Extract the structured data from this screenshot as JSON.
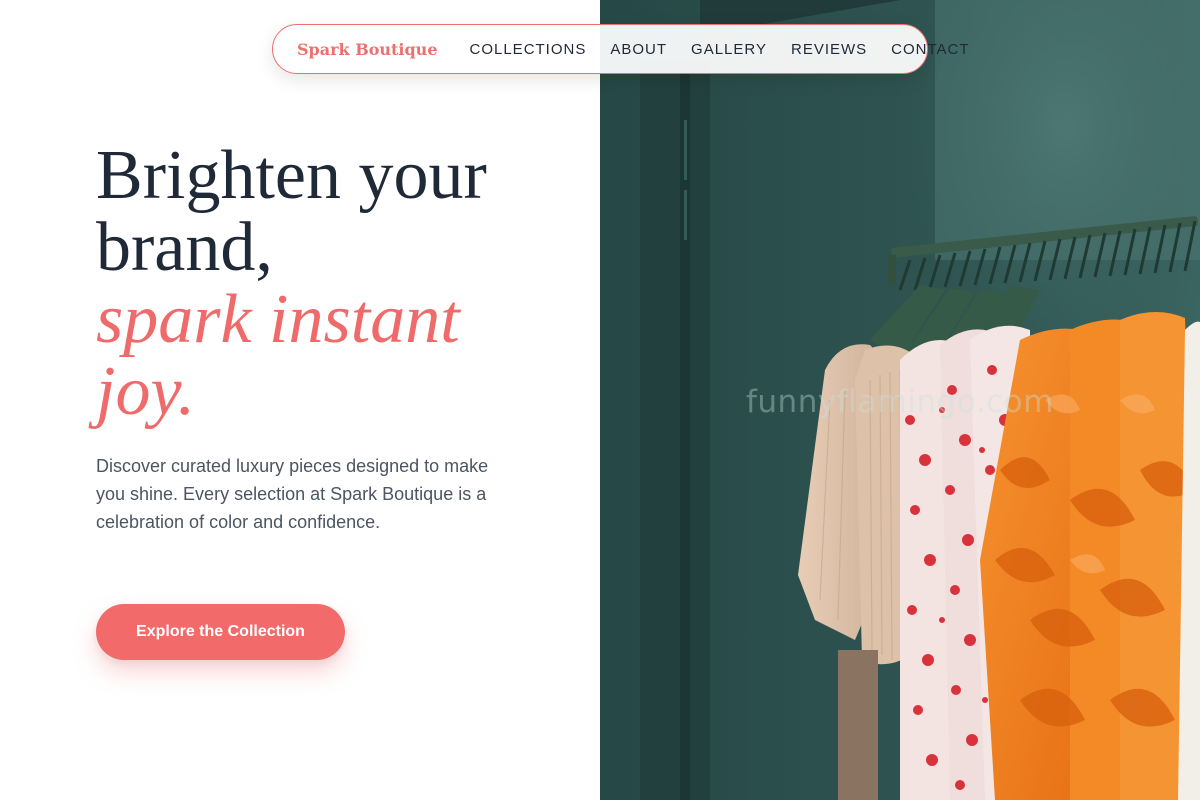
{
  "brand": {
    "name": "Spark Boutique"
  },
  "nav": {
    "links": [
      "COLLECTIONS",
      "ABOUT",
      "GALLERY",
      "REVIEWS",
      "CONTACT"
    ]
  },
  "hero": {
    "title_line1": "Brighten your",
    "title_line2": "brand,",
    "accent_line1": "spark instant",
    "accent_line2": "joy.",
    "description": "Discover curated luxury pieces designed to make you shine. Every selection at Spark Boutique is a celebration of color and confidence.",
    "cta_label": "Explore the Collection"
  },
  "image": {
    "subject": "clothing rack with hanging garments",
    "watermark": "funnyflamingo.com"
  },
  "colors": {
    "accent": "#ef6b6b",
    "heading": "#1f2937",
    "body": "#4b5563",
    "wall": "#2f5452"
  }
}
